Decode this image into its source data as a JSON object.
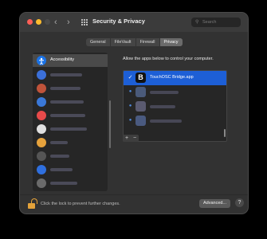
{
  "window": {
    "title": "Security & Privacy",
    "search_placeholder": "Search",
    "back_glyph": "‹",
    "forward_glyph": "›"
  },
  "tabs": [
    {
      "label": "General",
      "active": false
    },
    {
      "label": "FileVault",
      "active": false
    },
    {
      "label": "Firewall",
      "active": false
    },
    {
      "label": "Privacy",
      "active": true
    }
  ],
  "sidebar": {
    "selected_label": "Accessibility",
    "items": [
      {
        "label": "Accessibility",
        "icon": "accessibility-icon",
        "color": "#1a73e8",
        "selected": true
      },
      {
        "label": "",
        "icon": "location-icon",
        "color": "#3b6fd8"
      },
      {
        "label": "",
        "icon": "contacts-icon",
        "color": "#c0533a"
      },
      {
        "label": "",
        "icon": "folder-icon",
        "color": "#3a78d8"
      },
      {
        "label": "",
        "icon": "calendar-icon",
        "color": "#e84a4a"
      },
      {
        "label": "",
        "icon": "reminders-icon",
        "color": "#e8e8e8"
      },
      {
        "label": "",
        "icon": "photos-icon",
        "color": "#e6a23c"
      },
      {
        "label": "",
        "icon": "camera-icon",
        "color": "#4a4a4a"
      },
      {
        "label": "",
        "icon": "bluetooth-icon",
        "color": "#2f6fde"
      },
      {
        "label": "",
        "icon": "microphone-icon",
        "color": "#6b6b6b"
      }
    ]
  },
  "panel": {
    "instruction": "Allow the apps below to control your computer.",
    "apps": [
      {
        "label": "TouchOSC Bridge.app",
        "icon_glyph": "B",
        "checked": true,
        "selected": true
      },
      {
        "label": "",
        "icon_glyph": "",
        "checked": true,
        "selected": false
      },
      {
        "label": "",
        "icon_glyph": "",
        "checked": true,
        "selected": false
      },
      {
        "label": "",
        "icon_glyph": "",
        "checked": true,
        "selected": false
      }
    ],
    "add_glyph": "+",
    "remove_glyph": "−"
  },
  "footer": {
    "lock_text": "Click the lock to prevent further changes.",
    "advanced_label": "Advanced...",
    "help_glyph": "?"
  },
  "colors": {
    "selection_blue": "#1d5fd6",
    "lock_orange": "#e3a23a",
    "window_bg": "#323232"
  }
}
